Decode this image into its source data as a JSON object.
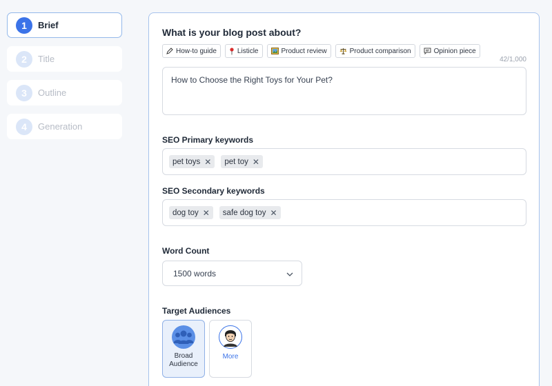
{
  "steps": [
    {
      "num": "1",
      "label": "Brief"
    },
    {
      "num": "2",
      "label": "Title"
    },
    {
      "num": "3",
      "label": "Outline"
    },
    {
      "num": "4",
      "label": "Generation"
    }
  ],
  "brief": {
    "question": "What is your blog post about?",
    "chips": [
      {
        "icon": "pencil-icon",
        "label": "How-to guide"
      },
      {
        "icon": "pushpin-icon",
        "label": "Listicle"
      },
      {
        "icon": "framed-picture-icon",
        "label": "Product review"
      },
      {
        "icon": "scales-icon",
        "label": "Product comparison"
      },
      {
        "icon": "speech-bubble-icon",
        "label": "Opinion piece"
      }
    ],
    "char_count": "42/1,000",
    "topic": "How to Choose the Right Toys for Your Pet?"
  },
  "seo_primary": {
    "label": "SEO Primary keywords",
    "tags": [
      "pet toys",
      "pet toy"
    ]
  },
  "seo_secondary": {
    "label": "SEO Secondary keywords",
    "tags": [
      "dog toy",
      "safe dog toy"
    ]
  },
  "word_count": {
    "label": "Word Count",
    "value": "1500 words"
  },
  "audiences": {
    "label": "Target Audiences",
    "options": [
      {
        "label": "Broad Audience",
        "icon": "group-icon"
      },
      {
        "label": "More",
        "icon": "person-avatar-icon"
      }
    ]
  },
  "colors": {
    "accent": "#3b73e8",
    "active_border": "#93b8ea"
  }
}
